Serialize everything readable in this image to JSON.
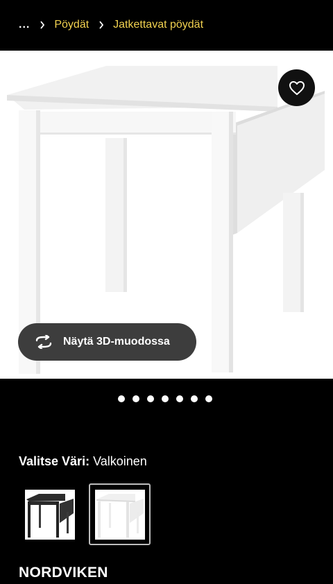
{
  "breadcrumb": {
    "ellipsis": "...",
    "items": [
      {
        "label": "Pöydät"
      },
      {
        "label": "Jatkettavat pöydät"
      }
    ]
  },
  "hero": {
    "favorite_icon": "heart-outline-icon",
    "view3d": {
      "label": "Näytä 3D-muodossa",
      "icon": "rotate-3d-icon"
    }
  },
  "carousel": {
    "dot_count": 7
  },
  "color": {
    "label": "Valitse Väri:",
    "value": "Valkoinen",
    "options": [
      {
        "name": "black",
        "selected": false
      },
      {
        "name": "white",
        "selected": true
      }
    ]
  },
  "product": {
    "name": "NORDVIKEN"
  },
  "colors": {
    "accent": "#f2d250",
    "background": "#000000",
    "button_dark": "#3d3d3d"
  }
}
